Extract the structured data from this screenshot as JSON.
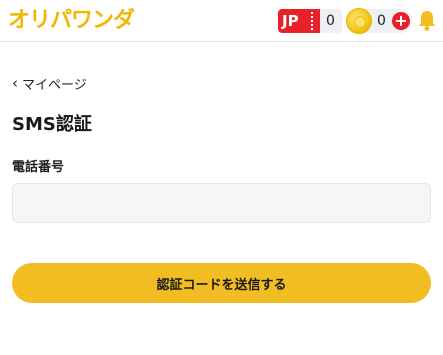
{
  "header": {
    "logo_text": "オリパワンダ",
    "jp_badge": {
      "label": "JP",
      "value": "0"
    },
    "coin_badge": {
      "value": "0",
      "add_symbol": "+"
    },
    "icons": {
      "coin": "coin-icon",
      "add": "plus-circle-icon",
      "bell": "bell-icon"
    }
  },
  "nav": {
    "back_chevron": "‹",
    "back_label": "マイページ"
  },
  "main": {
    "title": "SMS認証",
    "phone_label": "電話番号",
    "phone_value": "",
    "phone_placeholder": "",
    "submit_label": "認証コードを送信する"
  },
  "colors": {
    "brand_yellow": "#f1bd22",
    "logo_yellow": "#f2b705",
    "jp_red": "#e8202a"
  }
}
